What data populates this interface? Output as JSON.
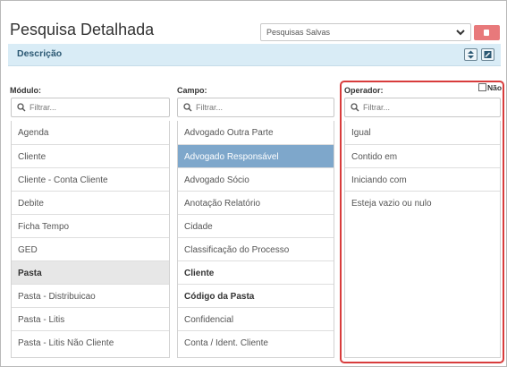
{
  "header": {
    "title": "Pesquisa Detalhada",
    "saved_searches": "Pesquisas Salvas"
  },
  "description_bar": {
    "label": "Descrição"
  },
  "modulo": {
    "label": "Módulo:",
    "filter_placeholder": "Filtrar...",
    "items": [
      "Agenda",
      "Cliente",
      "Cliente - Conta Cliente",
      "Debite",
      "Ficha Tempo",
      "GED",
      "Pasta",
      "Pasta - Distribuicao",
      "Pasta - Litis",
      "Pasta - Litis Não Cliente"
    ],
    "highlighted": "Pasta"
  },
  "campo": {
    "label": "Campo:",
    "filter_placeholder": "Filtrar...",
    "items": [
      "Advogado Outra Parte",
      "Advogado Responsável",
      "Advogado Sócio",
      "Anotação Relatório",
      "Cidade",
      "Classificação do Processo",
      "Cliente",
      "Código da Pasta",
      "Confidencial",
      "Conta / Ident. Cliente"
    ],
    "selected": "Advogado Responsável",
    "bold_items": [
      "Cliente",
      "Código da Pasta"
    ]
  },
  "operador": {
    "label": "Operador:",
    "nao_label": "Não",
    "nao_checked": false,
    "filter_placeholder": "Filtrar...",
    "items": [
      "Igual",
      "Contido em",
      "Iniciando com",
      "Esteja vazio ou nulo"
    ]
  },
  "colors": {
    "selected_row": "#7ea7cb",
    "highlight_row": "#e7e7e7",
    "description_bar": "#d9ecf6",
    "delete_button": "#e8797b",
    "annotation_border": "#d83c3c"
  }
}
